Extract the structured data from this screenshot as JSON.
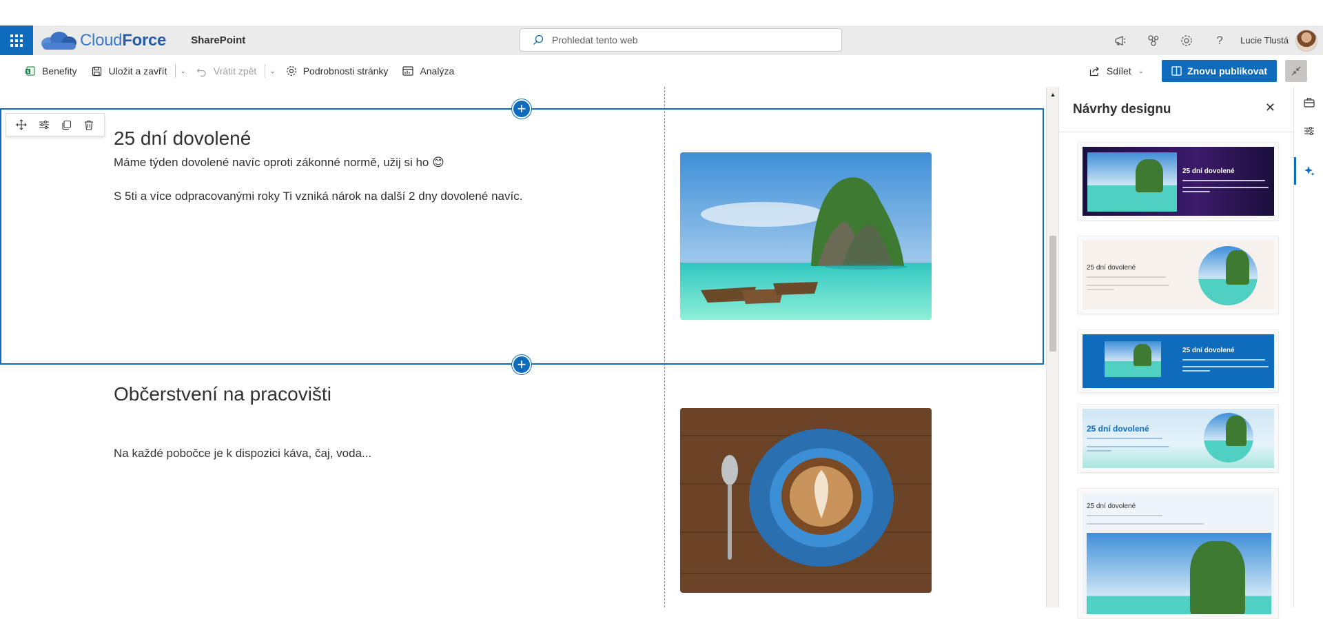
{
  "suite": {
    "brand_light": "Cloud",
    "brand_bold": "Force",
    "app_name": "SharePoint",
    "search_placeholder": "Prohledat tento web",
    "user_name": "Lucie Tlustá",
    "icons": [
      "megaphone-icon",
      "network-icon",
      "gear-icon",
      "help-icon"
    ]
  },
  "commands": {
    "benefity": "Benefity",
    "save_close": "Uložit a zavřít",
    "undo": "Vrátit zpět",
    "page_details": "Podrobnosti stránky",
    "analytics": "Analýza",
    "share": "Sdílet",
    "republish": "Znovu publikovat"
  },
  "sections": [
    {
      "heading": "25 dní dovolené",
      "paragraphs": [
        "Máme týden dovolené navíc oproti zákonné normě, užij si ho 😊",
        "S 5ti a více odpracovanými roky Ti vzniká nárok na další 2 dny dovolené navíc."
      ],
      "image": "tropical-beach-boats"
    },
    {
      "heading": "Občerstvení na pracovišti",
      "paragraphs": [
        "Na každé pobočce je k dispozici káva, čaj, voda..."
      ],
      "image": "latte-coffee-cup"
    }
  ],
  "design_panel": {
    "title": "Návrhy designu",
    "cards": [
      {
        "title": "25 dní dovolené",
        "style": "dark-purple"
      },
      {
        "title": "25 dní dovolené",
        "style": "light-circle"
      },
      {
        "title": "25 dní dovolené",
        "style": "blue-band"
      },
      {
        "title": "25 dní dovolené",
        "style": "light-blue-circle"
      },
      {
        "title": "25 dní dovolené",
        "style": "stacked"
      }
    ]
  },
  "colors": {
    "accent": "#0f6cbd",
    "suitebar": "#ebebeb"
  }
}
